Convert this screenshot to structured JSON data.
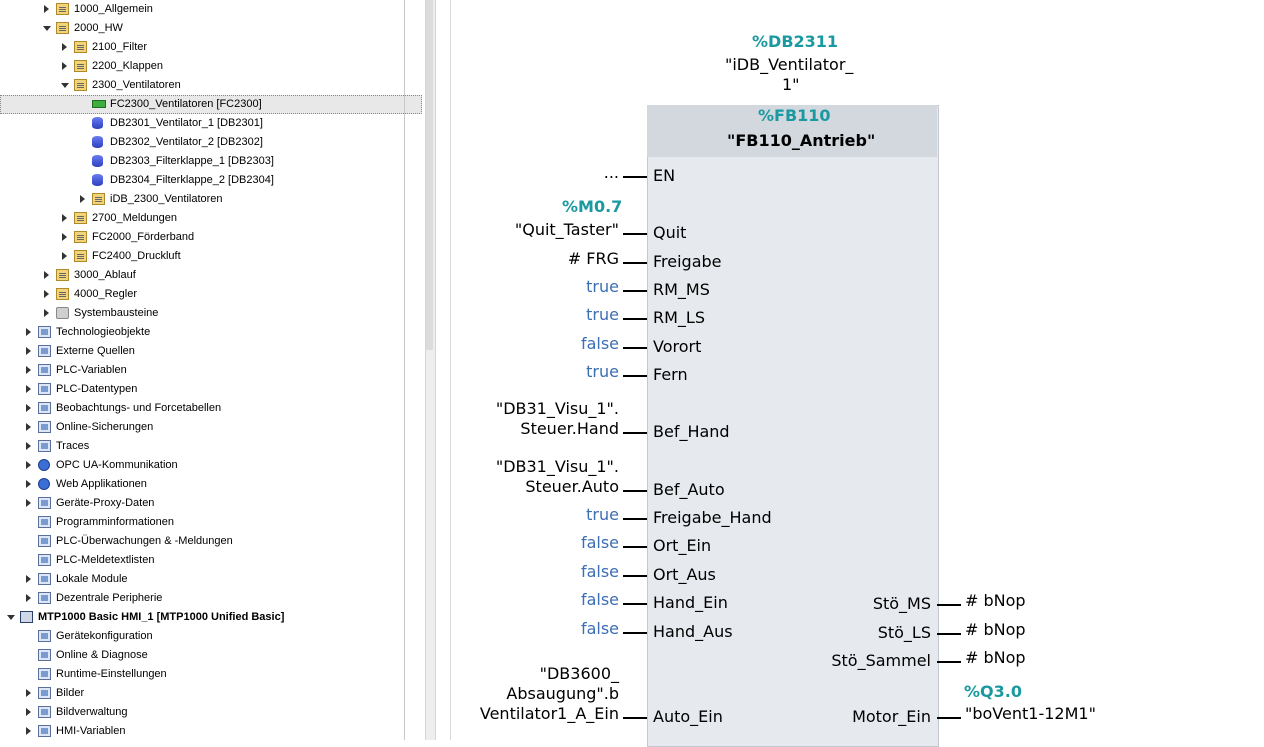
{
  "tree": [
    {
      "label": "1000_Allgemein",
      "indent": 2,
      "arrow": "collapsed",
      "icon": "folder"
    },
    {
      "label": "2000_HW",
      "indent": 2,
      "arrow": "expanded",
      "icon": "folder"
    },
    {
      "label": "2100_Filter",
      "indent": 3,
      "arrow": "collapsed",
      "icon": "folder"
    },
    {
      "label": "2200_Klappen",
      "indent": 3,
      "arrow": "collapsed",
      "icon": "folder"
    },
    {
      "label": "2300_Ventilatoren",
      "indent": 3,
      "arrow": "expanded",
      "icon": "folder"
    },
    {
      "label": "FC2300_Ventilatoren [FC2300]",
      "indent": 4,
      "arrow": "none",
      "icon": "fc",
      "selected": true
    },
    {
      "label": "DB2301_Ventilator_1 [DB2301]",
      "indent": 4,
      "arrow": "none",
      "icon": "db"
    },
    {
      "label": "DB2302_Ventilator_2 [DB2302]",
      "indent": 4,
      "arrow": "none",
      "icon": "db"
    },
    {
      "label": "DB2303_Filterklappe_1 [DB2303]",
      "indent": 4,
      "arrow": "none",
      "icon": "db"
    },
    {
      "label": "DB2304_Filterklappe_2 [DB2304]",
      "indent": 4,
      "arrow": "none",
      "icon": "db"
    },
    {
      "label": "iDB_2300_Ventilatoren",
      "indent": 4,
      "arrow": "collapsed",
      "icon": "folder"
    },
    {
      "label": "2700_Meldungen",
      "indent": 3,
      "arrow": "collapsed",
      "icon": "folder"
    },
    {
      "label": "FC2000_Förderband",
      "indent": 3,
      "arrow": "collapsed",
      "icon": "folder"
    },
    {
      "label": "FC2400_Druckluft",
      "indent": 3,
      "arrow": "collapsed",
      "icon": "folder"
    },
    {
      "label": "3000_Ablauf",
      "indent": 2,
      "arrow": "collapsed",
      "icon": "folder"
    },
    {
      "label": "4000_Regler",
      "indent": 2,
      "arrow": "collapsed",
      "icon": "folder"
    },
    {
      "label": "Systembausteine",
      "indent": 2,
      "arrow": "collapsed",
      "icon": "sys"
    },
    {
      "label": "Technologieobjekte",
      "indent": 1,
      "arrow": "collapsed",
      "icon": "gen"
    },
    {
      "label": "Externe Quellen",
      "indent": 1,
      "arrow": "collapsed",
      "icon": "gen"
    },
    {
      "label": "PLC-Variablen",
      "indent": 1,
      "arrow": "collapsed",
      "icon": "gen"
    },
    {
      "label": "PLC-Datentypen",
      "indent": 1,
      "arrow": "collapsed",
      "icon": "gen"
    },
    {
      "label": "Beobachtungs- und Forcetabellen",
      "indent": 1,
      "arrow": "collapsed",
      "icon": "gen"
    },
    {
      "label": "Online-Sicherungen",
      "indent": 1,
      "arrow": "collapsed",
      "icon": "gen"
    },
    {
      "label": "Traces",
      "indent": 1,
      "arrow": "collapsed",
      "icon": "gen"
    },
    {
      "label": "OPC UA-Kommunikation",
      "indent": 1,
      "arrow": "collapsed",
      "icon": "blue"
    },
    {
      "label": "Web Applikationen",
      "indent": 1,
      "arrow": "collapsed",
      "icon": "blue"
    },
    {
      "label": "Geräte-Proxy-Daten",
      "indent": 1,
      "arrow": "collapsed",
      "icon": "gen"
    },
    {
      "label": "Programminformationen",
      "indent": 1,
      "arrow": "none",
      "icon": "gen"
    },
    {
      "label": "PLC-Überwachungen & -Meldungen",
      "indent": 1,
      "arrow": "none",
      "icon": "gen"
    },
    {
      "label": "PLC-Meldetextlisten",
      "indent": 1,
      "arrow": "none",
      "icon": "gen"
    },
    {
      "label": "Lokale Module",
      "indent": 1,
      "arrow": "collapsed",
      "icon": "gen"
    },
    {
      "label": "Dezentrale Peripherie",
      "indent": 1,
      "arrow": "collapsed",
      "icon": "gen"
    },
    {
      "label": "MTP1000 Basic HMI_1 [MTP1000 Unified Basic]",
      "indent": 0,
      "arrow": "expanded",
      "icon": "dev",
      "bold": true
    },
    {
      "label": "Gerätekonfiguration",
      "indent": 1,
      "arrow": "none",
      "icon": "gen"
    },
    {
      "label": "Online & Diagnose",
      "indent": 1,
      "arrow": "none",
      "icon": "gen"
    },
    {
      "label": "Runtime-Einstellungen",
      "indent": 1,
      "arrow": "none",
      "icon": "gen"
    },
    {
      "label": "Bilder",
      "indent": 1,
      "arrow": "collapsed",
      "icon": "gen"
    },
    {
      "label": "Bildverwaltung",
      "indent": 1,
      "arrow": "collapsed",
      "icon": "gen"
    },
    {
      "label": "HMI-Variablen",
      "indent": 1,
      "arrow": "collapsed",
      "icon": "gen"
    }
  ],
  "fbd": {
    "instance_db_address": "%DB2311",
    "instance_db_name_line1": "\"iDB_Ventilator_",
    "instance_db_name_line2": "1\"",
    "block_address": "%FB110",
    "block_name": "\"FB110_Antrieb\"",
    "m07_address": "%M0.7",
    "q30_address": "%Q3.0",
    "inputs": [
      {
        "pin": "EN",
        "value": "...",
        "style": "plain"
      },
      {
        "pin": "Quit",
        "value": "\"Quit_Taster\"",
        "style": "plain"
      },
      {
        "pin": "Freigabe",
        "value": "# FRG",
        "style": "plain"
      },
      {
        "pin": "RM_MS",
        "value": "true",
        "style": "blue"
      },
      {
        "pin": "RM_LS",
        "value": "true",
        "style": "blue"
      },
      {
        "pin": "Vorort",
        "value": "false",
        "style": "blue"
      },
      {
        "pin": "Fern",
        "value": "true",
        "style": "blue"
      },
      {
        "pin": "Bef_Hand",
        "value_lines": [
          "\"DB31_Visu_1\".",
          "Steuer.Hand"
        ],
        "style": "plain"
      },
      {
        "pin": "Bef_Auto",
        "value_lines": [
          "\"DB31_Visu_1\".",
          "Steuer.Auto"
        ],
        "style": "plain"
      },
      {
        "pin": "Freigabe_Hand",
        "value": "true",
        "style": "blue"
      },
      {
        "pin": "Ort_Ein",
        "value": "false",
        "style": "blue"
      },
      {
        "pin": "Ort_Aus",
        "value": "false",
        "style": "blue"
      },
      {
        "pin": "Hand_Ein",
        "value": "false",
        "style": "blue"
      },
      {
        "pin": "Hand_Aus",
        "value": "false",
        "style": "blue"
      },
      {
        "pin": "Auto_Ein",
        "value_lines": [
          "\"DB3600_",
          "Absaugung\".b",
          "Ventilator1_A_Ein"
        ],
        "style": "plain"
      }
    ],
    "outputs": [
      {
        "pin": "Stö_MS",
        "value": "# bNop"
      },
      {
        "pin": "Stö_LS",
        "value": "# bNop"
      },
      {
        "pin": "Stö_Sammel",
        "value": "# bNop"
      },
      {
        "pin": "Motor_Ein",
        "value": "\"boVent1-12M1\""
      }
    ]
  }
}
